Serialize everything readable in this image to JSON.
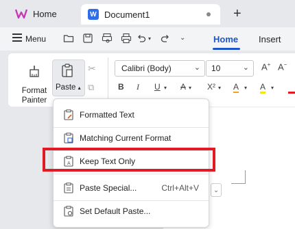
{
  "tabs": {
    "home": "Home",
    "document": "Document1",
    "new_tab": "+"
  },
  "menubar": {
    "menu": "Menu",
    "ribbon_tabs": [
      "Home",
      "Insert"
    ]
  },
  "clipboard": {
    "format_painter": [
      "Format",
      "Painter"
    ],
    "paste": "Paste"
  },
  "font": {
    "family": "Calibri (Body)",
    "size": "10"
  },
  "format_buttons": [
    "B",
    "I",
    "U",
    "A",
    "X²",
    "A",
    "A"
  ],
  "paste_menu": {
    "items": [
      {
        "label": "Formatted Text",
        "shortcut": ""
      },
      {
        "label": "Matching Current Format",
        "shortcut": ""
      },
      {
        "label": "Keep Text Only",
        "shortcut": ""
      },
      {
        "label": "Paste Special...",
        "shortcut": "Ctrl+Alt+V"
      },
      {
        "label": "Set Default Paste...",
        "shortcut": ""
      }
    ]
  },
  "colors": {
    "accent": "#1d54c7",
    "highlight": "#e01b24",
    "logo": "#c43bb5"
  }
}
